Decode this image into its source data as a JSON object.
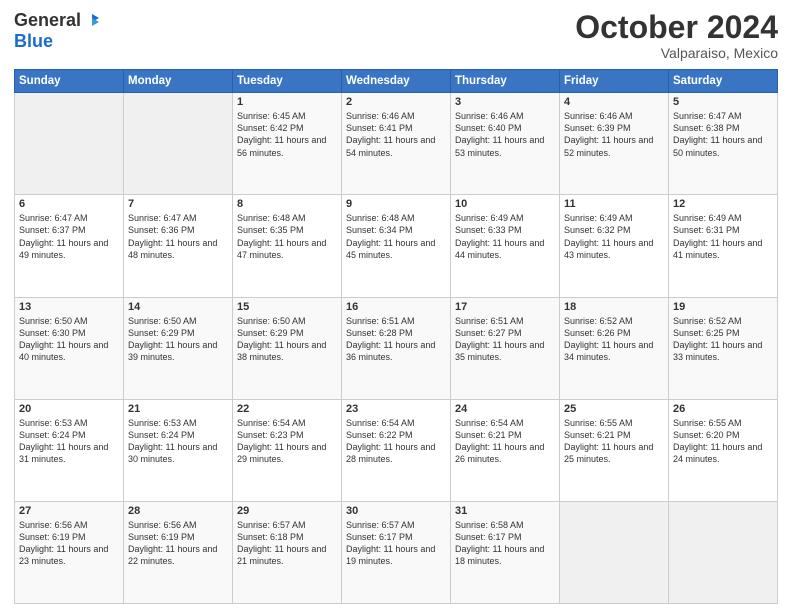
{
  "header": {
    "logo_general": "General",
    "logo_blue": "Blue",
    "month_title": "October 2024",
    "location": "Valparaiso, Mexico"
  },
  "weekdays": [
    "Sunday",
    "Monday",
    "Tuesday",
    "Wednesday",
    "Thursday",
    "Friday",
    "Saturday"
  ],
  "weeks": [
    [
      {
        "day": "",
        "info": ""
      },
      {
        "day": "",
        "info": ""
      },
      {
        "day": "1",
        "info": "Sunrise: 6:45 AM\nSunset: 6:42 PM\nDaylight: 11 hours and 56 minutes."
      },
      {
        "day": "2",
        "info": "Sunrise: 6:46 AM\nSunset: 6:41 PM\nDaylight: 11 hours and 54 minutes."
      },
      {
        "day": "3",
        "info": "Sunrise: 6:46 AM\nSunset: 6:40 PM\nDaylight: 11 hours and 53 minutes."
      },
      {
        "day": "4",
        "info": "Sunrise: 6:46 AM\nSunset: 6:39 PM\nDaylight: 11 hours and 52 minutes."
      },
      {
        "day": "5",
        "info": "Sunrise: 6:47 AM\nSunset: 6:38 PM\nDaylight: 11 hours and 50 minutes."
      }
    ],
    [
      {
        "day": "6",
        "info": "Sunrise: 6:47 AM\nSunset: 6:37 PM\nDaylight: 11 hours and 49 minutes."
      },
      {
        "day": "7",
        "info": "Sunrise: 6:47 AM\nSunset: 6:36 PM\nDaylight: 11 hours and 48 minutes."
      },
      {
        "day": "8",
        "info": "Sunrise: 6:48 AM\nSunset: 6:35 PM\nDaylight: 11 hours and 47 minutes."
      },
      {
        "day": "9",
        "info": "Sunrise: 6:48 AM\nSunset: 6:34 PM\nDaylight: 11 hours and 45 minutes."
      },
      {
        "day": "10",
        "info": "Sunrise: 6:49 AM\nSunset: 6:33 PM\nDaylight: 11 hours and 44 minutes."
      },
      {
        "day": "11",
        "info": "Sunrise: 6:49 AM\nSunset: 6:32 PM\nDaylight: 11 hours and 43 minutes."
      },
      {
        "day": "12",
        "info": "Sunrise: 6:49 AM\nSunset: 6:31 PM\nDaylight: 11 hours and 41 minutes."
      }
    ],
    [
      {
        "day": "13",
        "info": "Sunrise: 6:50 AM\nSunset: 6:30 PM\nDaylight: 11 hours and 40 minutes."
      },
      {
        "day": "14",
        "info": "Sunrise: 6:50 AM\nSunset: 6:29 PM\nDaylight: 11 hours and 39 minutes."
      },
      {
        "day": "15",
        "info": "Sunrise: 6:50 AM\nSunset: 6:29 PM\nDaylight: 11 hours and 38 minutes."
      },
      {
        "day": "16",
        "info": "Sunrise: 6:51 AM\nSunset: 6:28 PM\nDaylight: 11 hours and 36 minutes."
      },
      {
        "day": "17",
        "info": "Sunrise: 6:51 AM\nSunset: 6:27 PM\nDaylight: 11 hours and 35 minutes."
      },
      {
        "day": "18",
        "info": "Sunrise: 6:52 AM\nSunset: 6:26 PM\nDaylight: 11 hours and 34 minutes."
      },
      {
        "day": "19",
        "info": "Sunrise: 6:52 AM\nSunset: 6:25 PM\nDaylight: 11 hours and 33 minutes."
      }
    ],
    [
      {
        "day": "20",
        "info": "Sunrise: 6:53 AM\nSunset: 6:24 PM\nDaylight: 11 hours and 31 minutes."
      },
      {
        "day": "21",
        "info": "Sunrise: 6:53 AM\nSunset: 6:24 PM\nDaylight: 11 hours and 30 minutes."
      },
      {
        "day": "22",
        "info": "Sunrise: 6:54 AM\nSunset: 6:23 PM\nDaylight: 11 hours and 29 minutes."
      },
      {
        "day": "23",
        "info": "Sunrise: 6:54 AM\nSunset: 6:22 PM\nDaylight: 11 hours and 28 minutes."
      },
      {
        "day": "24",
        "info": "Sunrise: 6:54 AM\nSunset: 6:21 PM\nDaylight: 11 hours and 26 minutes."
      },
      {
        "day": "25",
        "info": "Sunrise: 6:55 AM\nSunset: 6:21 PM\nDaylight: 11 hours and 25 minutes."
      },
      {
        "day": "26",
        "info": "Sunrise: 6:55 AM\nSunset: 6:20 PM\nDaylight: 11 hours and 24 minutes."
      }
    ],
    [
      {
        "day": "27",
        "info": "Sunrise: 6:56 AM\nSunset: 6:19 PM\nDaylight: 11 hours and 23 minutes."
      },
      {
        "day": "28",
        "info": "Sunrise: 6:56 AM\nSunset: 6:19 PM\nDaylight: 11 hours and 22 minutes."
      },
      {
        "day": "29",
        "info": "Sunrise: 6:57 AM\nSunset: 6:18 PM\nDaylight: 11 hours and 21 minutes."
      },
      {
        "day": "30",
        "info": "Sunrise: 6:57 AM\nSunset: 6:17 PM\nDaylight: 11 hours and 19 minutes."
      },
      {
        "day": "31",
        "info": "Sunrise: 6:58 AM\nSunset: 6:17 PM\nDaylight: 11 hours and 18 minutes."
      },
      {
        "day": "",
        "info": ""
      },
      {
        "day": "",
        "info": ""
      }
    ]
  ]
}
